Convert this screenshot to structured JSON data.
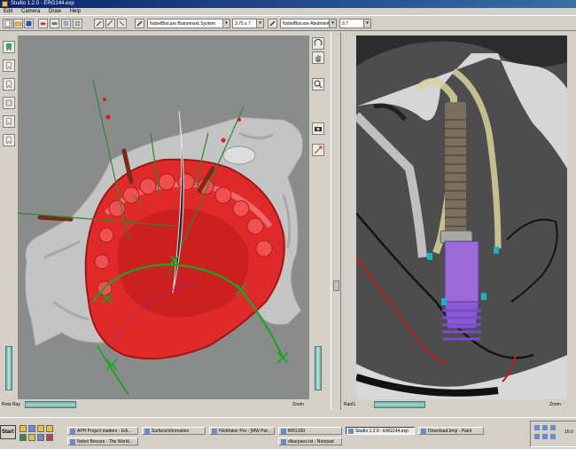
{
  "window": {
    "title": "Studio 1.2.0 - ERG144.exp"
  },
  "menu": [
    "Edit",
    "Camera",
    "Draw",
    "Help"
  ],
  "toolbar": {
    "implant_system": "NobelBiocare Branemark System",
    "implant_size": "3.75 x 7",
    "abutment_system": "NobelBiocare Abutment",
    "abutment_size": "3.7"
  },
  "status": {
    "left_label": "Rota Ray",
    "left_zoom": "Zoom",
    "right_label": "Rant1",
    "right_zoom": "Zoom"
  },
  "taskbar": {
    "start": "Start",
    "tasks": [
      [
        "APH Project matters - Edi..."
      ],
      [
        "Nobel Biocare - The World..."
      ],
      [
        "SurfaceInformation"
      ],
      [
        "FileMaker Pro - [MW Pat..."
      ],
      [
        "BRG100"
      ],
      [
        "Studio 1.2.0 - ERG144.exp"
      ],
      [
        "Download.bmp - Paint"
      ],
      [
        "dikarpaes.txt - Notepad"
      ]
    ],
    "clock": "16:0"
  },
  "colors": {
    "titlebar": "#0a246a",
    "gum_guide": "#d92828",
    "implant_purple": "#9b6ad8",
    "guide_curve": "#1aa526",
    "chrome": "#d4d0c8"
  },
  "icons": {
    "left_tools": [
      "tooth-icon",
      "tooth-icon",
      "tooth-icon",
      "tooth-icon",
      "tooth-icon",
      "tooth-icon"
    ],
    "mid_tools": [
      "rotate-icon",
      "hand-icon",
      "zoom-icon",
      "camera-icon",
      "arrows-icon"
    ]
  }
}
